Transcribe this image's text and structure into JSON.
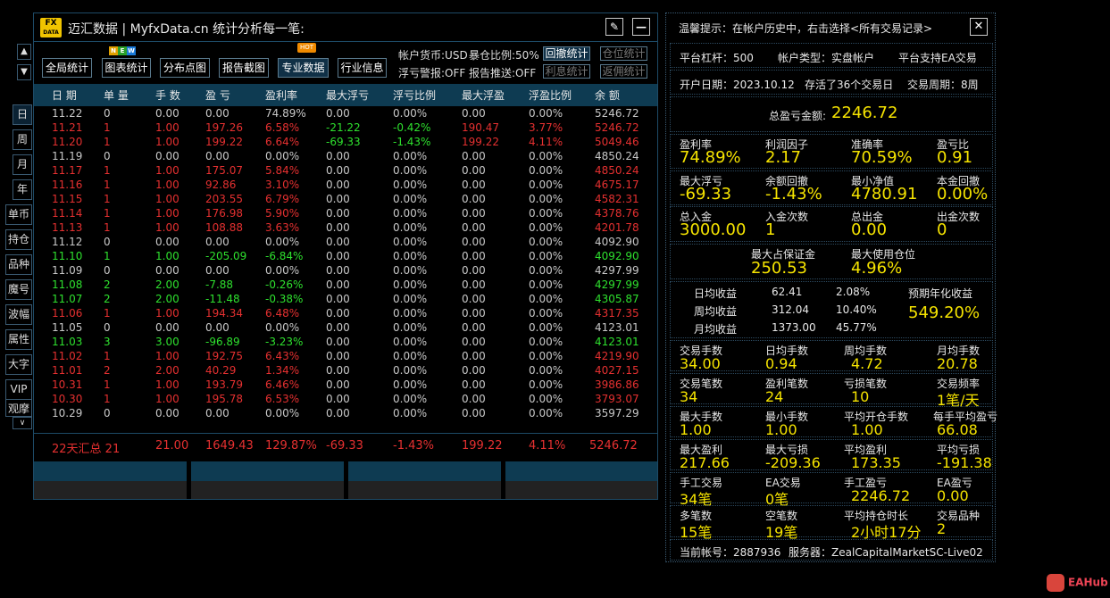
{
  "nav": {
    "up_arrow": "▲",
    "down_arrow": "▼",
    "collapse": "∨",
    "items": [
      "日",
      "周",
      "月",
      "年",
      "单币",
      "持仓",
      "品种",
      "魔号",
      "波幅",
      "属性",
      "大字",
      "VIP",
      "观摩"
    ]
  },
  "window": {
    "logo_top": "FX",
    "logo_bottom": "DATA",
    "title": "迈汇数据 | MyfxData.cn  统计分析每一笔:",
    "edit_icon": "✎",
    "minimize_icon": "—"
  },
  "toolbar": {
    "buttons": [
      "全局统计",
      "图表统计",
      "分布点图",
      "报告截图",
      "专业数据",
      "行业信息"
    ],
    "new_badge": [
      "N",
      "E",
      "W"
    ],
    "hot_badge": "HOT",
    "account_currency": "帐户货币:USD",
    "blast_ratio": "暴仓比例:50%",
    "float_loss_alert": "浮亏警报:OFF",
    "report_push": "报告推送:OFF",
    "small_buttons": [
      "回撤统计",
      "仓位统计",
      "利息统计",
      "返佣统计"
    ]
  },
  "table": {
    "headers": [
      "日 期",
      "单 量",
      "手 数",
      "盈 亏",
      "盈利率",
      "最大浮亏",
      "浮亏比例",
      "最大浮盈",
      "浮盈比例",
      "余 额"
    ],
    "rows": [
      {
        "c": [
          "11.22",
          "0",
          "0.00",
          "0.00",
          "74.89%",
          "0.00",
          "0.00%",
          "0.00",
          "0.00%",
          "5246.72"
        ],
        "color": "#c8c8c8"
      },
      {
        "c": [
          "11.21",
          "1",
          "1.00",
          "197.26",
          "6.58%",
          "-21.22",
          "-0.42%",
          "190.47",
          "3.77%",
          "5246.72"
        ],
        "color": "#e53030"
      },
      {
        "c": [
          "11.20",
          "1",
          "1.00",
          "199.22",
          "6.64%",
          "-69.33",
          "-1.43%",
          "199.22",
          "4.11%",
          "5049.46"
        ],
        "color": "#e53030"
      },
      {
        "c": [
          "11.19",
          "0",
          "0.00",
          "0.00",
          "0.00%",
          "0.00",
          "0.00%",
          "0.00",
          "0.00%",
          "4850.24"
        ],
        "color": "#c8c8c8"
      },
      {
        "c": [
          "11.17",
          "1",
          "1.00",
          "175.07",
          "5.84%",
          "0.00",
          "0.00%",
          "0.00",
          "0.00%",
          "4850.24"
        ],
        "color": "#e53030"
      },
      {
        "c": [
          "11.16",
          "1",
          "1.00",
          "92.86",
          "3.10%",
          "0.00",
          "0.00%",
          "0.00",
          "0.00%",
          "4675.17"
        ],
        "color": "#e53030"
      },
      {
        "c": [
          "11.15",
          "1",
          "1.00",
          "203.55",
          "6.79%",
          "0.00",
          "0.00%",
          "0.00",
          "0.00%",
          "4582.31"
        ],
        "color": "#e53030"
      },
      {
        "c": [
          "11.14",
          "1",
          "1.00",
          "176.98",
          "5.90%",
          "0.00",
          "0.00%",
          "0.00",
          "0.00%",
          "4378.76"
        ],
        "color": "#e53030"
      },
      {
        "c": [
          "11.13",
          "1",
          "1.00",
          "108.88",
          "3.63%",
          "0.00",
          "0.00%",
          "0.00",
          "0.00%",
          "4201.78"
        ],
        "color": "#e53030"
      },
      {
        "c": [
          "11.12",
          "0",
          "0.00",
          "0.00",
          "0.00%",
          "0.00",
          "0.00%",
          "0.00",
          "0.00%",
          "4092.90"
        ],
        "color": "#c8c8c8"
      },
      {
        "c": [
          "11.10",
          "1",
          "1.00",
          "-205.09",
          "-6.84%",
          "0.00",
          "0.00%",
          "0.00",
          "0.00%",
          "4092.90"
        ],
        "color": "#2ee02e"
      },
      {
        "c": [
          "11.09",
          "0",
          "0.00",
          "0.00",
          "0.00%",
          "0.00",
          "0.00%",
          "0.00",
          "0.00%",
          "4297.99"
        ],
        "color": "#c8c8c8"
      },
      {
        "c": [
          "11.08",
          "2",
          "2.00",
          "-7.88",
          "-0.26%",
          "0.00",
          "0.00%",
          "0.00",
          "0.00%",
          "4297.99"
        ],
        "color": "#2ee02e"
      },
      {
        "c": [
          "11.07",
          "2",
          "2.00",
          "-11.48",
          "-0.38%",
          "0.00",
          "0.00%",
          "0.00",
          "0.00%",
          "4305.87"
        ],
        "color": "#2ee02e"
      },
      {
        "c": [
          "11.06",
          "1",
          "1.00",
          "194.34",
          "6.48%",
          "0.00",
          "0.00%",
          "0.00",
          "0.00%",
          "4317.35"
        ],
        "color": "#e53030"
      },
      {
        "c": [
          "11.05",
          "0",
          "0.00",
          "0.00",
          "0.00%",
          "0.00",
          "0.00%",
          "0.00",
          "0.00%",
          "4123.01"
        ],
        "color": "#c8c8c8"
      },
      {
        "c": [
          "11.03",
          "3",
          "3.00",
          "-96.89",
          "-3.23%",
          "0.00",
          "0.00%",
          "0.00",
          "0.00%",
          "4123.01"
        ],
        "color": "#2ee02e"
      },
      {
        "c": [
          "11.02",
          "1",
          "1.00",
          "192.75",
          "6.43%",
          "0.00",
          "0.00%",
          "0.00",
          "0.00%",
          "4219.90"
        ],
        "color": "#e53030"
      },
      {
        "c": [
          "11.01",
          "2",
          "2.00",
          "40.29",
          "1.34%",
          "0.00",
          "0.00%",
          "0.00",
          "0.00%",
          "4027.15"
        ],
        "color": "#e53030"
      },
      {
        "c": [
          "10.31",
          "1",
          "1.00",
          "193.79",
          "6.46%",
          "0.00",
          "0.00%",
          "0.00",
          "0.00%",
          "3986.86"
        ],
        "color": "#e53030"
      },
      {
        "c": [
          "10.30",
          "1",
          "1.00",
          "195.78",
          "6.53%",
          "0.00",
          "0.00%",
          "0.00",
          "0.00%",
          "3793.07"
        ],
        "color": "#e53030"
      },
      {
        "c": [
          "10.29",
          "0",
          "0.00",
          "0.00",
          "0.00%",
          "0.00",
          "0.00%",
          "0.00",
          "0.00%",
          "3597.29"
        ],
        "color": "#c8c8c8"
      }
    ],
    "footer": [
      "22天汇总 21",
      "21.00",
      "1649.43",
      "129.87%",
      "-69.33",
      "-1.43%",
      "199.22",
      "4.11%",
      "5246.72"
    ]
  },
  "right": {
    "tip": "温馨提示：在帐户历史中，右击选择<所有交易记录>",
    "close": "✕",
    "leverage": "平台杠杆：500",
    "account_type": "帐户类型：实盘帐户",
    "ea_support": "平台支持EA交易",
    "open_date": "开户日期：2023.10.12",
    "alive_days": "存活了36个交易日",
    "trade_period": "交易周期：8周",
    "total_pl_label": "总盈亏金额:",
    "total_pl_value": "2246.72",
    "stats1": [
      {
        "label": "盈利率",
        "value": "74.89%"
      },
      {
        "label": "利润因子",
        "value": "2.17"
      },
      {
        "label": "准确率",
        "value": "70.59%"
      },
      {
        "label": "盈亏比",
        "value": "0.91"
      },
      {
        "label": "最大浮亏",
        "value": "-69.33"
      },
      {
        "label": "余额回撤",
        "value": "-1.43%"
      },
      {
        "label": "最小净值",
        "value": "4780.91"
      },
      {
        "label": "本金回撤",
        "value": "0.00%"
      },
      {
        "label": "总入金",
        "value": "3000.00"
      },
      {
        "label": "入金次数",
        "value": "1"
      },
      {
        "label": "总出金",
        "value": "0.00"
      },
      {
        "label": "出金次数",
        "value": "0"
      }
    ],
    "margin": [
      {
        "label": "最大占保证金",
        "value": "250.53"
      },
      {
        "label": "最大使用仓位",
        "value": "4.96%"
      }
    ],
    "avg": {
      "rows": [
        {
          "label": "日均收益",
          "v1": "62.41",
          "v2": "2.08%"
        },
        {
          "label": "周均收益",
          "v1": "312.04",
          "v2": "10.40%"
        },
        {
          "label": "月均收益",
          "v1": "1373.00",
          "v2": "45.77%"
        }
      ],
      "annual_label": "预期年化收益",
      "annual_value": "549.20%"
    },
    "stats2": [
      {
        "label": "交易手数",
        "value": "34.00"
      },
      {
        "label": "日均手数",
        "value": "0.94"
      },
      {
        "label": "周均手数",
        "value": "4.72"
      },
      {
        "label": "月均手数",
        "value": "20.78"
      },
      {
        "label": "交易笔数",
        "value": "34"
      },
      {
        "label": "盈利笔数",
        "value": "24"
      },
      {
        "label": "亏损笔数",
        "value": "10"
      },
      {
        "label": "交易频率",
        "value": "1笔/天"
      },
      {
        "label": "最大手数",
        "value": "1.00"
      },
      {
        "label": "最小手数",
        "value": "1.00"
      },
      {
        "label": "平均开仓手数",
        "value": "1.00"
      },
      {
        "label": "每手平均盈亏",
        "value": "66.08"
      },
      {
        "label": "最大盈利",
        "value": "217.66"
      },
      {
        "label": "最大亏损",
        "value": "-209.36"
      },
      {
        "label": "平均盈利",
        "value": "173.35"
      },
      {
        "label": "平均亏损",
        "value": "-191.38"
      },
      {
        "label": "手工交易",
        "value": "34笔"
      },
      {
        "label": "EA交易",
        "value": "0笔"
      },
      {
        "label": "手工盈亏",
        "value": "2246.72"
      },
      {
        "label": "EA盈亏",
        "value": "0.00"
      },
      {
        "label": "多笔数",
        "value": "15笔"
      },
      {
        "label": "空笔数",
        "value": "19笔"
      },
      {
        "label": "平均持仓时长",
        "value": "2小时17分"
      },
      {
        "label": "交易品种",
        "value": "2"
      }
    ],
    "account_no": "当前帐号：2887936",
    "server": "服务器：ZealCapitalMarketSC-Live02"
  },
  "watermark": {
    "text": "EAHub"
  }
}
